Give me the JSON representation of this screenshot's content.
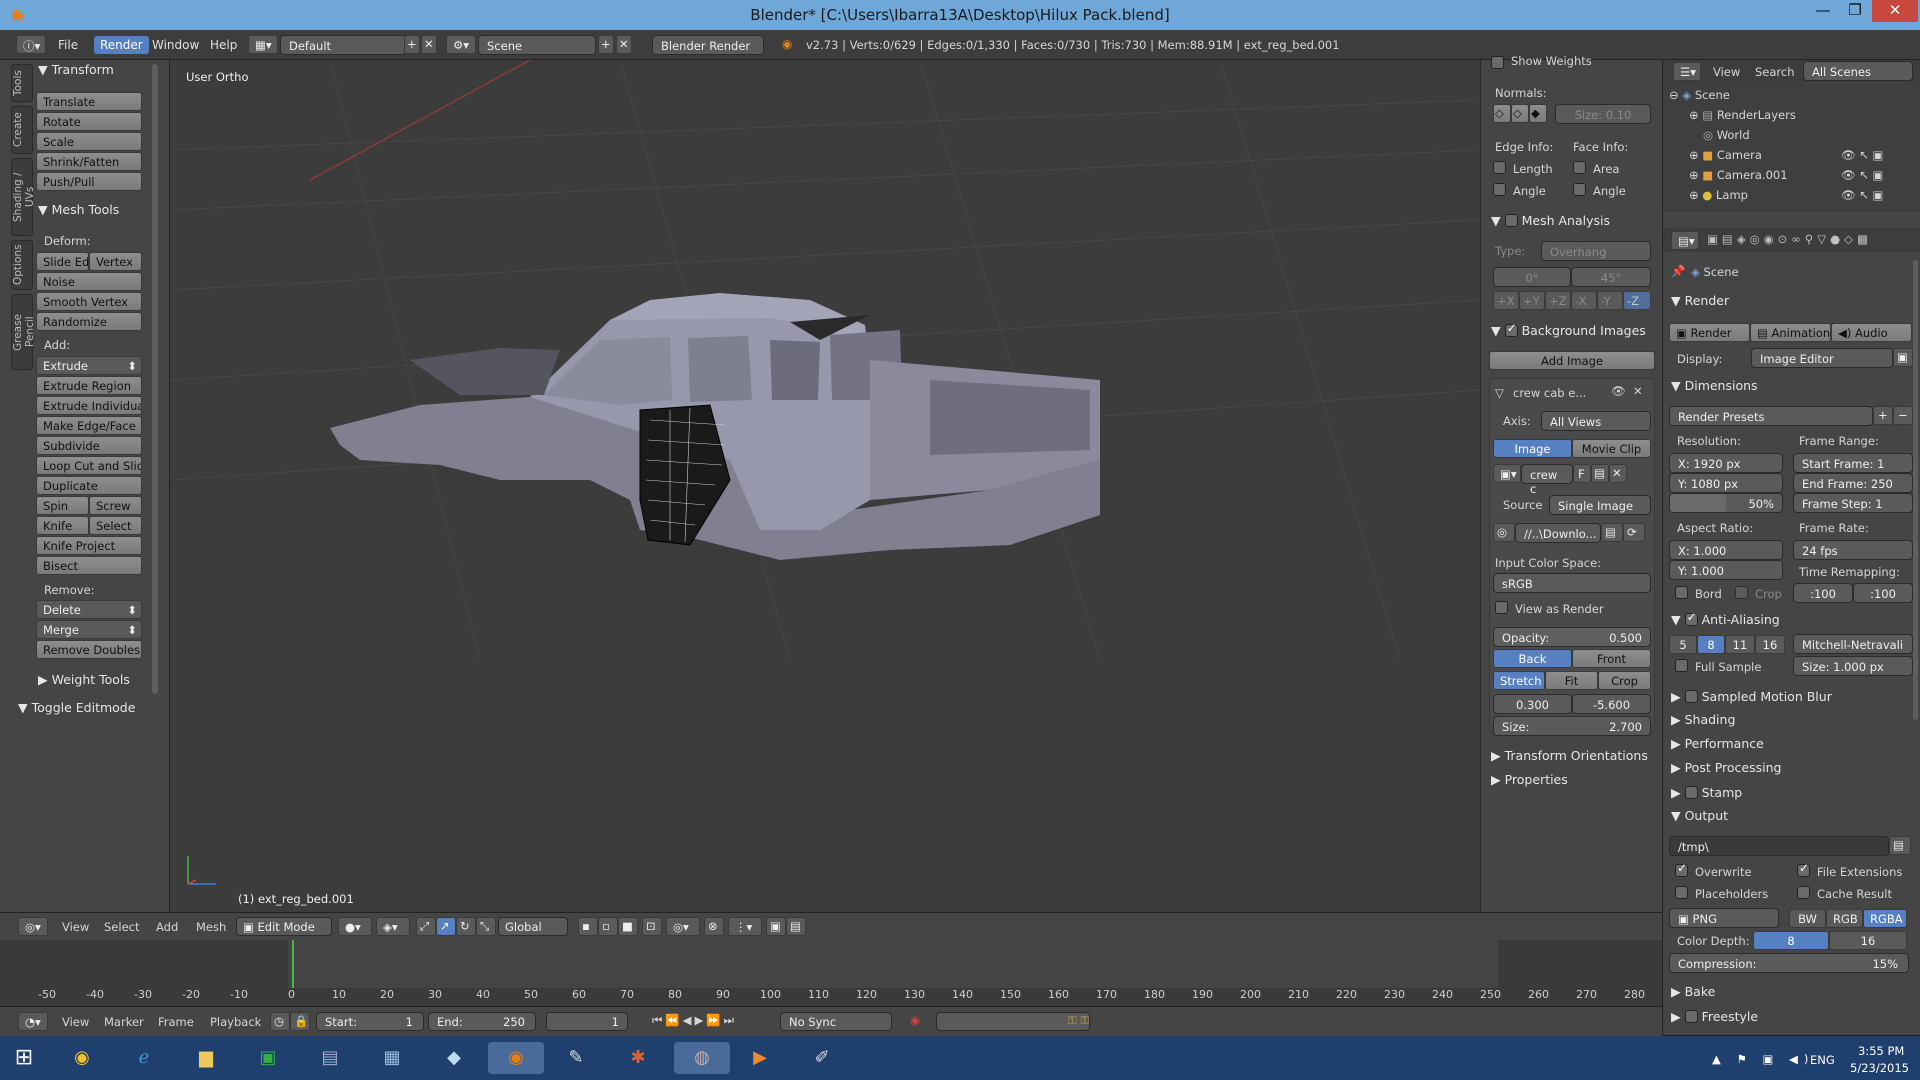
{
  "window": {
    "title": "Blender* [C:\\Users\\Ibarra13A\\Desktop\\Hilux Pack.blend]",
    "minimize": "—",
    "maximize": "❐",
    "close": "✕"
  },
  "topbar": {
    "menus": [
      "File",
      "Render",
      "Window",
      "Help"
    ],
    "active_menu": "Render",
    "layout": "Default",
    "scene": "Scene",
    "engine": "Blender Render",
    "stats": "v2.73 | Verts:0/629 | Edges:0/1,330 | Faces:0/730 | Tris:730 | Mem:88.91M | ext_reg_bed.001"
  },
  "left": {
    "tabs": [
      "Tools",
      "Create",
      "Shading / UVs",
      "Options",
      "Grease Pencil"
    ],
    "transform_header": "Transform",
    "transform": [
      "Translate",
      "Rotate",
      "Scale",
      "Shrink/Fatten",
      "Push/Pull"
    ],
    "mesh_tools_header": "Mesh Tools",
    "deform_label": "Deform:",
    "slide_edge": "Slide Ed",
    "vertex": "Vertex",
    "deform": [
      "Noise",
      "Smooth Vertex",
      "Randomize"
    ],
    "add_label": "Add:",
    "extrude": "Extrude",
    "add": [
      "Extrude Region",
      "Extrude Individual",
      "Make Edge/Face",
      "Subdivide",
      "Loop Cut and Slide",
      "Duplicate"
    ],
    "spin": "Spin",
    "screw": "Screw",
    "knife": "Knife",
    "select": "Select",
    "add2": [
      "Knife Project",
      "Bisect"
    ],
    "remove_label": "Remove:",
    "delete": "Delete",
    "merge": "Merge",
    "remove_doubles": "Remove Doubles",
    "weight_tools": "Weight Tools",
    "toggle_editmode": "Toggle Editmode"
  },
  "viewport": {
    "view_label": "User Ortho",
    "object_label": "(1) ext_reg_bed.001"
  },
  "npanel": {
    "show_weights": "Show Weights",
    "normals": "Normals:",
    "size_field": "Size:  0.10",
    "edge_info": "Edge Info:",
    "face_info": "Face Info:",
    "length": "Length",
    "area": "Area",
    "angle1": "Angle",
    "angle2": "Angle",
    "mesh_analysis": "Mesh Analysis",
    "type_label": "Type:",
    "type_value": "Overhang",
    "deg0": "0°",
    "deg45": "45°",
    "axes": [
      "+X",
      "+Y",
      "+Z",
      "-X",
      "-Y",
      "-Z"
    ],
    "bg_images": "Background Images",
    "add_image": "Add Image",
    "image_name": "crew cab e...",
    "axis_label": "Axis:",
    "axis_value": "All Views",
    "image_tab": "Image",
    "movie_clip_tab": "Movie Clip",
    "image_field": "crew c",
    "f_label": "F",
    "source_label": "Source",
    "source_value": "Single Image",
    "path": "//..\\Downlo...",
    "input_color_space": "Input Color Space:",
    "color_space": "sRGB",
    "view_as_render": "View as Render",
    "opacity_label": "Opacity:",
    "opacity_value": "0.500",
    "back": "Back",
    "front": "Front",
    "stretch": "Stretch",
    "fit": "Fit",
    "crop": "Crop",
    "offx": "0.300",
    "offy": "-5.600",
    "size_label": "Size:",
    "size_value": "2.700",
    "transform_orientations": "Transform Orientations",
    "properties": "Properties"
  },
  "outliner": {
    "view": "View",
    "search": "Search",
    "all_scenes": "All Scenes",
    "items": [
      "Scene",
      "RenderLayers",
      "World",
      "Camera",
      "Camera.001",
      "Lamp"
    ]
  },
  "props": {
    "scene_label": "Scene",
    "render_header": "Render",
    "render_btn": "Render",
    "animation_btn": "Animation",
    "audio_btn": "Audio",
    "display_label": "Display:",
    "display_value": "Image Editor",
    "dimensions": "Dimensions",
    "render_presets": "Render Presets",
    "resolution": "Resolution:",
    "frame_range": "Frame Range:",
    "res_x": "X:        1920 px",
    "res_y": "Y:        1080 px",
    "res_pct": "50%",
    "start_frame": "Start Frame:    1",
    "end_frame": "End Frame:  250",
    "frame_step": "Frame Step:    1",
    "aspect_ratio": "Aspect Ratio:",
    "frame_rate": "Frame Rate:",
    "asp_x": "X:        1.000",
    "asp_y": "Y:        1.000",
    "fps": "24 fps",
    "time_remapping": "Time Remapping:",
    "bord": "Bord",
    "crop": "Crop",
    "remap_old": ":100",
    "remap_new": ":100",
    "anti_aliasing": "Anti-Aliasing",
    "aa_samples": [
      "5",
      "8",
      "11",
      "16"
    ],
    "aa_filter": "Mitchell-Netravali",
    "full_sample": "Full Sample",
    "aa_size": "Size:   1.000 px",
    "sampled_motion_blur": "Sampled Motion Blur",
    "shading": "Shading",
    "performance": "Performance",
    "post_processing": "Post Processing",
    "stamp": "Stamp",
    "output": "Output",
    "output_path": "/tmp\\",
    "overwrite": "Overwrite",
    "file_extensions": "File Extensions",
    "placeholders": "Placeholders",
    "cache_result": "Cache Result",
    "format": "PNG",
    "bw": "BW",
    "rgb": "RGB",
    "rgba": "RGBA",
    "color_depth": "Color Depth:",
    "depth8": "8",
    "depth16": "16",
    "compression": "Compression:",
    "compression_value": "15%",
    "bake": "Bake",
    "freestyle": "Freestyle"
  },
  "viewport_header": {
    "menus": [
      "View",
      "Select",
      "Add",
      "Mesh"
    ],
    "mode": "Edit Mode",
    "orientation": "Global"
  },
  "timeline": {
    "ticks": [
      "-50",
      "-40",
      "-30",
      "-20",
      "-10",
      "0",
      "10",
      "20",
      "30",
      "40",
      "50",
      "60",
      "70",
      "80",
      "90",
      "100",
      "110",
      "120",
      "130",
      "140",
      "150",
      "160",
      "170",
      "180",
      "190",
      "200",
      "210",
      "220",
      "230",
      "240",
      "250",
      "260",
      "270",
      "280"
    ],
    "menus": [
      "View",
      "Marker",
      "Frame",
      "Playback"
    ],
    "start": "Start:",
    "start_value": "1",
    "end": "End:",
    "end_value": "250",
    "current": "1",
    "sync": "No Sync"
  },
  "taskbar": {
    "lang": "ENG",
    "time": "3:55 PM",
    "date": "5/23/2015"
  }
}
